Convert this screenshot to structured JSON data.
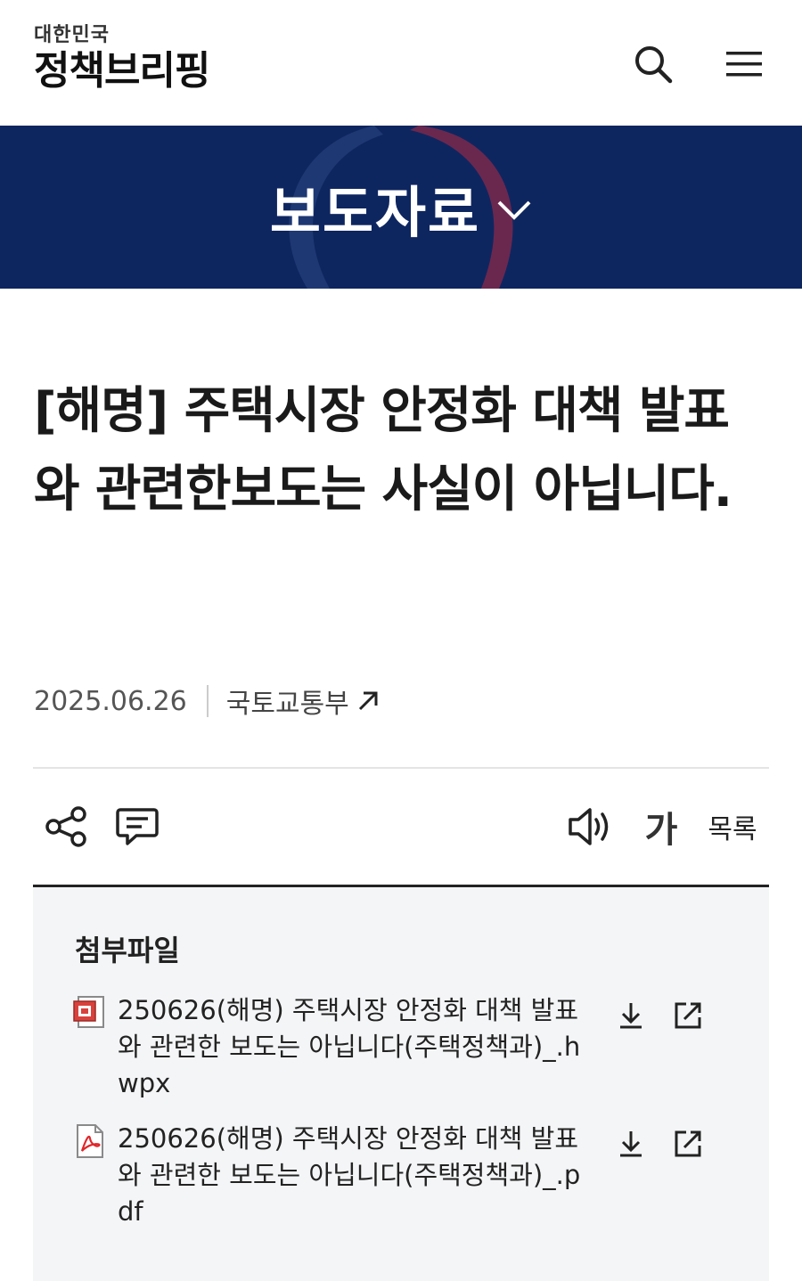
{
  "header": {
    "logo_top": "대한민국",
    "logo_main": "정책브리핑",
    "search_icon": "search-icon",
    "menu_icon": "hamburger-menu-icon"
  },
  "banner": {
    "title": "보도자료",
    "icon": "chevron-down-icon",
    "bg_color": "#0e2660"
  },
  "article": {
    "title": "[해명] 주택시장 안정화 대책 발표와 관련한보도는 사실이 아닙니다.",
    "date": "2025.06.26",
    "department": "국토교통부",
    "department_icon": "external-arrow-icon"
  },
  "toolbar": {
    "share_icon": "share-icon",
    "comment_icon": "comment-icon",
    "speak_icon": "speaker-icon",
    "font_label": "가",
    "list_label": "목록"
  },
  "attachments": {
    "title": "첨부파일",
    "files": [
      {
        "name": "250626(해명) 주택시장 안정화 대책 발표와 관련한 보도는 아닙니다(주택정책과)_.hwpx",
        "icon": "hwp-file-icon"
      },
      {
        "name": "250626(해명) 주택시장 안정화 대책 발표와 관련한 보도는 아닙니다(주택정책과)_.pdf",
        "icon": "pdf-file-icon"
      }
    ],
    "download_icon": "download-icon",
    "open_icon": "open-external-icon"
  },
  "colors": {
    "accent_red": "#d72d2d",
    "banner_navy": "#0e2660"
  }
}
